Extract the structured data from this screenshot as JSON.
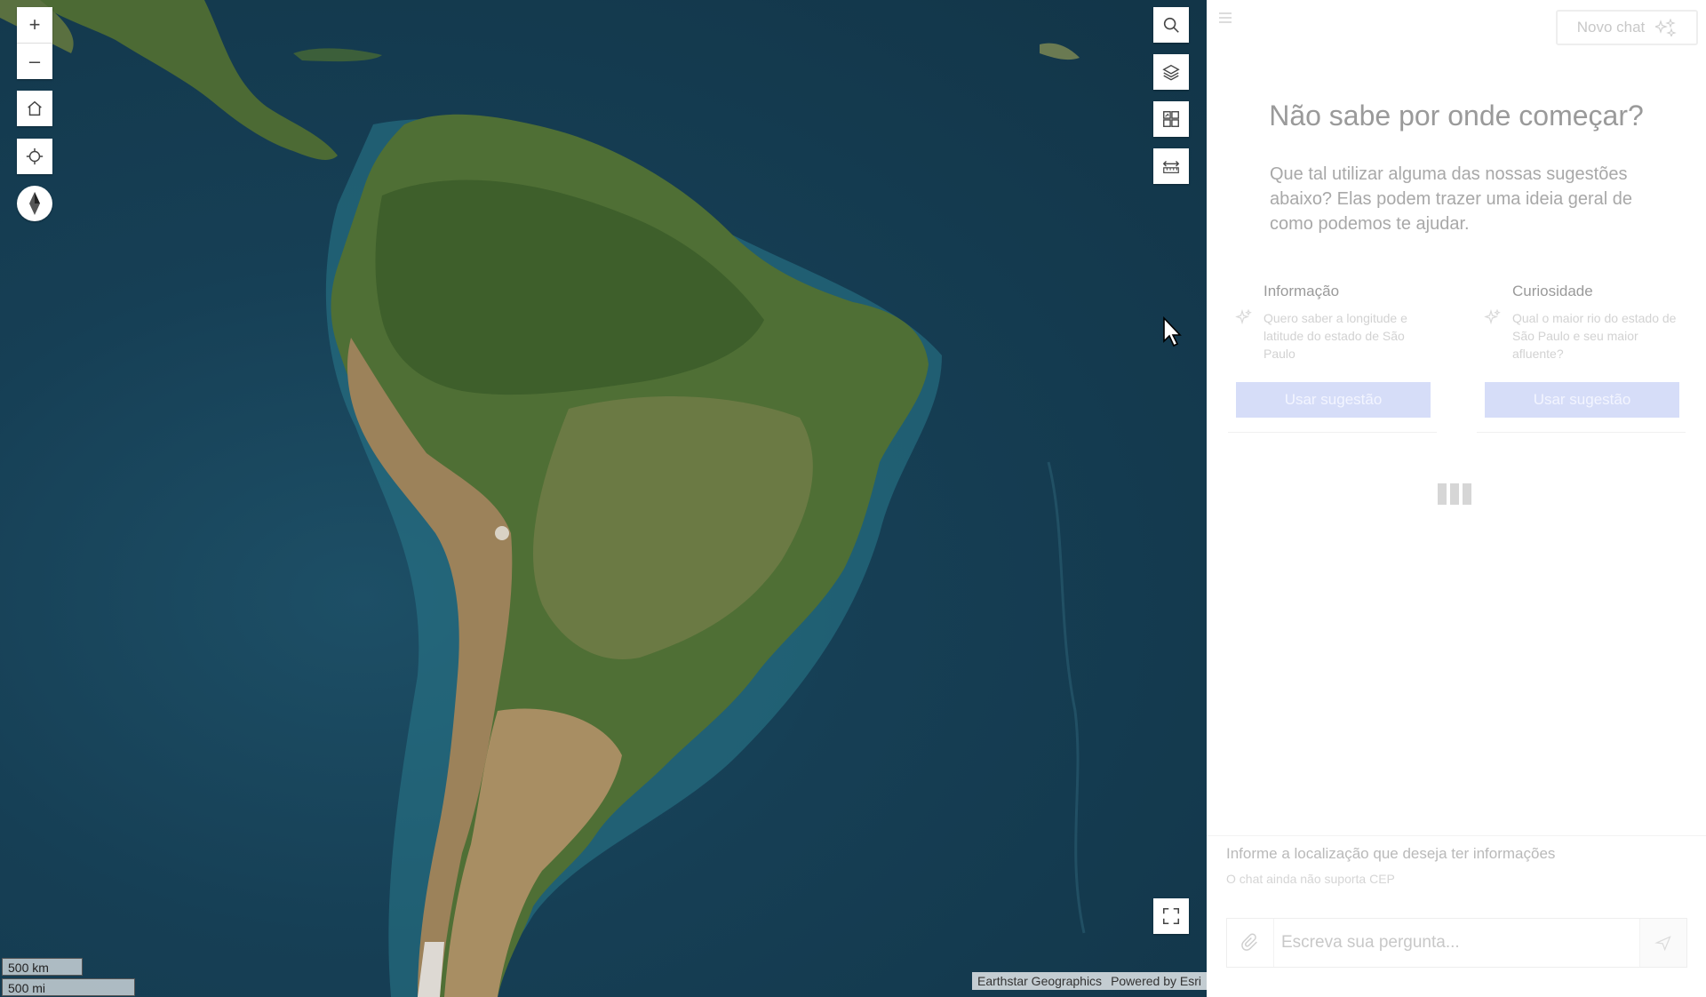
{
  "map": {
    "zoom_in_label": "+",
    "zoom_out_label": "–",
    "scale_km": "500 km",
    "scale_mi": "500 mi",
    "attribution": {
      "source": "Earthstar Geographics",
      "powered": "Powered by Esri"
    },
    "icons": {
      "home": "home-icon",
      "locate": "locate-icon",
      "compass": "compass-icon",
      "search": "search-icon",
      "layers": "layers-icon",
      "basemap": "basemap-gallery-icon",
      "measure": "measure-icon",
      "fullscreen": "fullscreen-icon"
    }
  },
  "panel": {
    "new_chat_label": "Novo chat",
    "heading": "Não sabe por onde começar?",
    "subtext": "Que tal utilizar alguma das nossas sugestões abaixo? Elas podem trazer uma ideia geral de como podemos te ajudar.",
    "suggestions": [
      {
        "title": "Informação",
        "text": "Quero saber a longitude e latitude do estado de São Paulo",
        "button": "Usar sugestão"
      },
      {
        "title": "Curiosidade",
        "text": "Qual o maior rio do estado de São Paulo e seu maior afluente?",
        "button": "Usar sugestão"
      }
    ],
    "hint_title": "Informe a localização que deseja ter informações",
    "hint_sub": "O chat ainda não suporta CEP",
    "input_placeholder": "Escreva sua pergunta..."
  }
}
